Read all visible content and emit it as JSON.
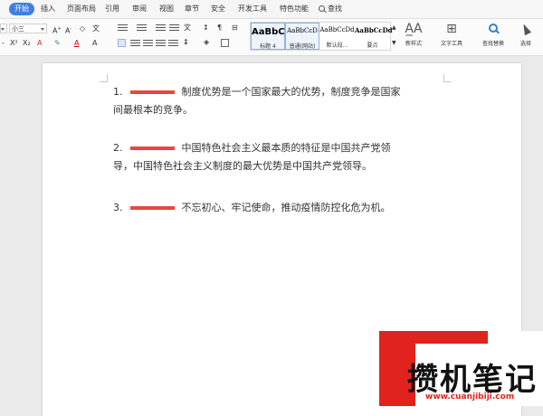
{
  "tabs": {
    "items": [
      "开始",
      "插入",
      "页面布局",
      "引用",
      "审阅",
      "视图",
      "章节",
      "安全",
      "开发工具",
      "特色功能"
    ],
    "active": "开始",
    "search_label": "查找"
  },
  "toolbar": {
    "font_size": "小三",
    "styles": [
      {
        "sample": "AaBbC",
        "name": "标题 4"
      },
      {
        "sample": "AaBbCcD",
        "name": "普通(网站)"
      },
      {
        "sample": "AaBbCcDd",
        "name": "默认段..."
      },
      {
        "sample": "AaBbCcDd",
        "name": "要点"
      }
    ],
    "new_style": "新样式",
    "text_tools": "文字工具",
    "find_replace": "查找替换",
    "select": "选择"
  },
  "document": {
    "paragraphs": [
      {
        "num": "1.",
        "text_first": "制度优势是一个国家最大的优势，制度竞争是国家",
        "text_rest": "间最根本的竞争。"
      },
      {
        "num": "2.",
        "text_first": "中国特色社会主义最本质的特征是中国共产党领",
        "text_rest": "导，中国特色社会主义制度的最大优势是中国共产党领导。"
      },
      {
        "num": "3.",
        "text_first": "不忘初心、牢记使命，推动疫情防控化危为机。",
        "text_rest": ""
      }
    ]
  },
  "watermark": {
    "title": "攒机笔记",
    "url": "www.cuanjibiji.com"
  },
  "colors": {
    "accent": "#3f7ee6",
    "redaction": "#e54840",
    "watermark_red": "#e0231d"
  }
}
